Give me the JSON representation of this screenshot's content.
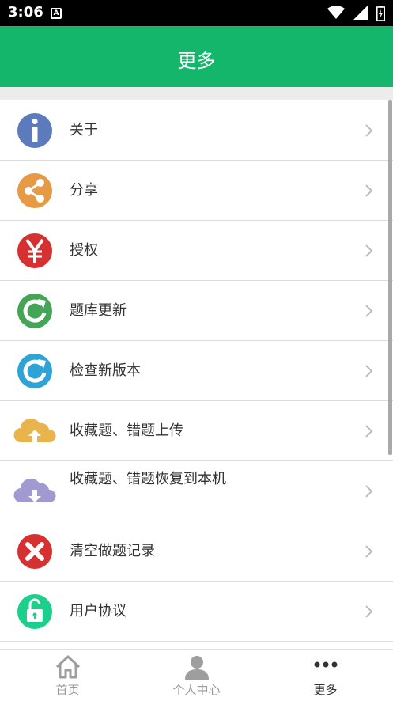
{
  "status_bar": {
    "time": "3:06",
    "notification": "A"
  },
  "header": {
    "title": "更多"
  },
  "menu": {
    "items": [
      {
        "label": "关于"
      },
      {
        "label": "分享"
      },
      {
        "label": "授权"
      },
      {
        "label": "题库更新"
      },
      {
        "label": "检查新版本"
      },
      {
        "label": "收藏题、错题上传"
      },
      {
        "label": "收藏题、错题恢复到本机"
      },
      {
        "label": "清空做题记录"
      },
      {
        "label": "用户协议"
      }
    ]
  },
  "icons": {
    "about": "info-icon",
    "share": "share-icon",
    "auth": "yen-icon",
    "bank_update": "refresh-icon",
    "check_version": "update-icon",
    "upload": "cloud-upload-icon",
    "restore": "cloud-download-icon",
    "clear": "close-icon",
    "agreement": "unlock-icon"
  },
  "colors": {
    "header": "#13b66a",
    "info": "#5b7bbd",
    "share": "#e79a45",
    "auth": "#d63030",
    "bank_update": "#44a556",
    "check_version": "#2ea3d6",
    "upload": "#e9b44c",
    "restore": "#a09ad0",
    "clear": "#d63030",
    "agreement": "#1ad08a"
  },
  "tabs": [
    {
      "label": "首页",
      "icon": "home-icon"
    },
    {
      "label": "个人中心",
      "icon": "user-icon"
    },
    {
      "label": "更多",
      "icon": "more-icon",
      "active": true
    }
  ]
}
